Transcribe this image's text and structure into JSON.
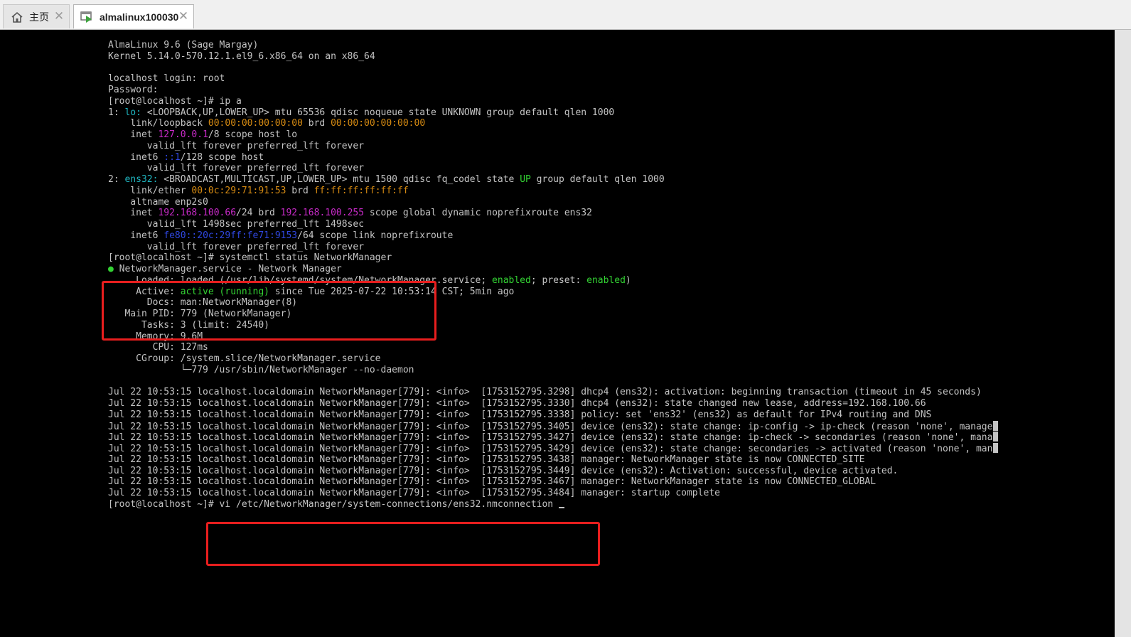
{
  "tabs": {
    "home": {
      "icon": "home-icon",
      "label": "主页",
      "close": "✕"
    },
    "vm": {
      "icon": "vm-icon",
      "label": "almalinux100030",
      "close": "✕"
    }
  },
  "colors": {
    "text": "#c4c4c4",
    "cyan": "#1fb5c0",
    "orange": "#d58a12",
    "magenta": "#c72ac7",
    "blue": "#2f47e0",
    "green": "#33d233",
    "highlight_box": "#e81e1e"
  },
  "terminal": {
    "lines": [
      [
        {
          "t": "AlmaLinux 9.6 (Sage Margay)"
        }
      ],
      [
        {
          "t": "Kernel 5.14.0-570.12.1.el9_6.x86_64 on an x86_64"
        }
      ],
      [],
      [
        {
          "t": "localhost login: root"
        }
      ],
      [
        {
          "t": "Password:"
        }
      ],
      [
        {
          "t": "[root@localhost ~]# ip a"
        }
      ],
      [
        {
          "t": "1: "
        },
        {
          "t": "lo:",
          "c": "cyan"
        },
        {
          "t": " <LOOPBACK,UP,LOWER_UP> mtu 65536 qdisc noqueue state UNKNOWN group default qlen 1000"
        }
      ],
      [
        {
          "t": "    link/loopback "
        },
        {
          "t": "00:00:00:00:00:00",
          "c": "orange"
        },
        {
          "t": " brd "
        },
        {
          "t": "00:00:00:00:00:00",
          "c": "orange"
        }
      ],
      [
        {
          "t": "    inet "
        },
        {
          "t": "127.0.0.1",
          "c": "magenta"
        },
        {
          "t": "/8 scope host lo"
        }
      ],
      [
        {
          "t": "       valid_lft forever preferred_lft forever"
        }
      ],
      [
        {
          "t": "    inet6 "
        },
        {
          "t": "::1",
          "c": "blue"
        },
        {
          "t": "/128 scope host"
        }
      ],
      [
        {
          "t": "       valid_lft forever preferred_lft forever"
        }
      ],
      [
        {
          "t": "2: "
        },
        {
          "t": "ens32:",
          "c": "cyan"
        },
        {
          "t": " <BROADCAST,MULTICAST,UP,LOWER_UP> mtu 1500 qdisc fq_codel state "
        },
        {
          "t": "UP",
          "c": "green"
        },
        {
          "t": " group default qlen 1000"
        }
      ],
      [
        {
          "t": "    link/ether "
        },
        {
          "t": "00:0c:29:71:91:53",
          "c": "orange"
        },
        {
          "t": " brd "
        },
        {
          "t": "ff:ff:ff:ff:ff:ff",
          "c": "orange"
        }
      ],
      [
        {
          "t": "    altname enp2s0"
        }
      ],
      [
        {
          "t": "    inet "
        },
        {
          "t": "192.168.100.66",
          "c": "magenta"
        },
        {
          "t": "/24 brd "
        },
        {
          "t": "192.168.100.255",
          "c": "magenta"
        },
        {
          "t": " scope global dynamic noprefixroute ens32"
        }
      ],
      [
        {
          "t": "       valid_lft 1498sec preferred_lft 1498sec"
        }
      ],
      [
        {
          "t": "    inet6 "
        },
        {
          "t": "fe80::20c:29ff:fe71:9153",
          "c": "blue"
        },
        {
          "t": "/64 scope link noprefixroute"
        }
      ],
      [
        {
          "t": "       valid_lft forever preferred_lft forever"
        }
      ],
      [
        {
          "t": "[root@localhost ~]# systemctl status NetworkManager"
        }
      ],
      [
        {
          "t": "●",
          "c": "green"
        },
        {
          "t": " NetworkManager.service - Network Manager"
        }
      ],
      [
        {
          "t": "     Loaded: loaded (/usr/lib/systemd/system/NetworkManager.service; "
        },
        {
          "t": "enabled",
          "c": "green"
        },
        {
          "t": "; preset: "
        },
        {
          "t": "enabled",
          "c": "green"
        },
        {
          "t": ")"
        }
      ],
      [
        {
          "t": "     Active: "
        },
        {
          "t": "active (running)",
          "c": "green"
        },
        {
          "t": " since Tue 2025-07-22 10:53:14 CST; 5min ago"
        }
      ],
      [
        {
          "t": "       Docs: man:NetworkManager(8)"
        }
      ],
      [
        {
          "t": "   Main PID: 779 (NetworkManager)"
        }
      ],
      [
        {
          "t": "      Tasks: 3 (limit: 24540)"
        }
      ],
      [
        {
          "t": "     Memory: 9.6M"
        }
      ],
      [
        {
          "t": "        CPU: 127ms"
        }
      ],
      [
        {
          "t": "     CGroup: /system.slice/NetworkManager.service"
        }
      ],
      [
        {
          "t": "             └─779 /usr/sbin/NetworkManager --no-daemon"
        }
      ],
      [],
      [
        {
          "t": "Jul 22 10:53:15 localhost.localdomain NetworkManager[779]: <info>  [1753152795.3298] dhcp4 (ens32): activation: beginning transaction (timeout in 45 seconds)"
        }
      ],
      [
        {
          "t": "Jul 22 10:53:15 localhost.localdomain NetworkManager[779]: <info>  [1753152795.3330] dhcp4 (ens32): state changed new lease, address=192.168.100.66"
        }
      ],
      [
        {
          "t": "Jul 22 10:53:15 localhost.localdomain NetworkManager[779]: <info>  [1753152795.3338] policy: set 'ens32' (ens32) as default for IPv4 routing and DNS"
        }
      ],
      [
        {
          "t": "Jul 22 10:53:15 localhost.localdomain NetworkManager[779]: <info>  [1753152795.3405] device (ens32): state change: ip-config -> ip-check (reason 'none', manage"
        },
        {
          "cont": true
        }
      ],
      [
        {
          "t": "Jul 22 10:53:15 localhost.localdomain NetworkManager[779]: <info>  [1753152795.3427] device (ens32): state change: ip-check -> secondaries (reason 'none', mana"
        },
        {
          "cont": true
        }
      ],
      [
        {
          "t": "Jul 22 10:53:15 localhost.localdomain NetworkManager[779]: <info>  [1753152795.3429] device (ens32): state change: secondaries -> activated (reason 'none', man"
        },
        {
          "cont": true
        }
      ],
      [
        {
          "t": "Jul 22 10:53:15 localhost.localdomain NetworkManager[779]: <info>  [1753152795.3438] manager: NetworkManager state is now CONNECTED_SITE"
        }
      ],
      [
        {
          "t": "Jul 22 10:53:15 localhost.localdomain NetworkManager[779]: <info>  [1753152795.3449] device (ens32): Activation: successful, device activated."
        }
      ],
      [
        {
          "t": "Jul 22 10:53:15 localhost.localdomain NetworkManager[779]: <info>  [1753152795.3467] manager: NetworkManager state is now CONNECTED_GLOBAL"
        }
      ],
      [
        {
          "t": "Jul 22 10:53:15 localhost.localdomain NetworkManager[779]: <info>  [1753152795.3484] manager: startup complete"
        }
      ],
      [
        {
          "t": "[root@localhost ~]# vi /etc/NetworkManager/system-connections/ens32.nmconnection "
        },
        {
          "cursor": true
        }
      ]
    ]
  }
}
